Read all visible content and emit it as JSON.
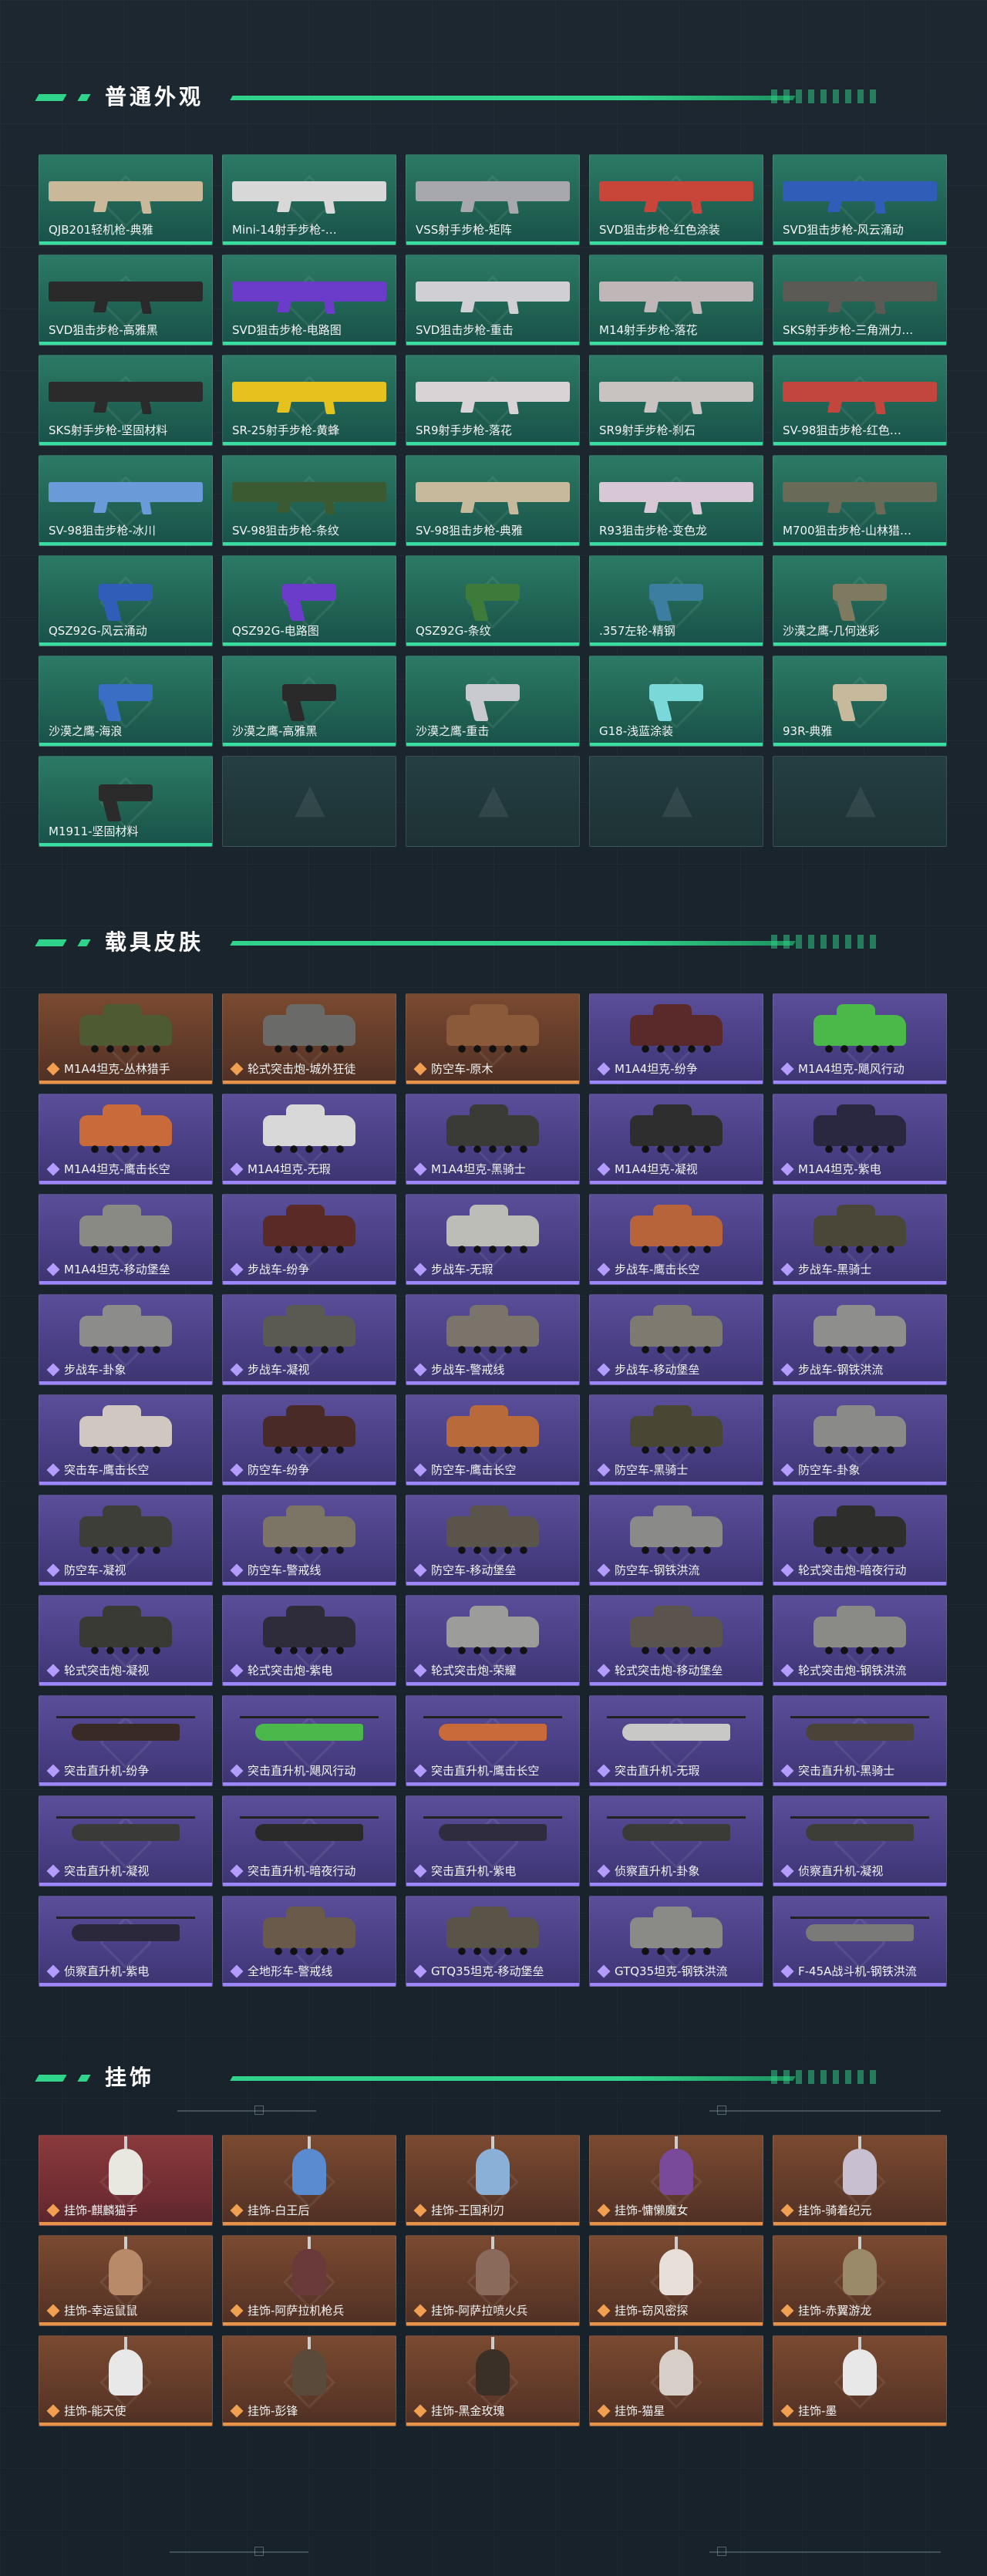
{
  "sections": {
    "weapons": {
      "title": "普通外观",
      "items": [
        {
          "label": "QJB201轻机枪-典雅",
          "color": "#c9b89a"
        },
        {
          "label": "Mini-14射手步枪-…",
          "color": "#d8d8d8"
        },
        {
          "label": "VSS射手步枪-矩阵",
          "color": "#a6a8ad"
        },
        {
          "label": "SVD狙击步枪-红色涂装",
          "color": "#c8453a"
        },
        {
          "label": "SVD狙击步枪-风云涌动",
          "color": "#2f5db8"
        },
        {
          "label": "SVD狙击步枪-高雅黑",
          "color": "#2a2a2a"
        },
        {
          "label": "SVD狙击步枪-电路图",
          "color": "#6a3cc9"
        },
        {
          "label": "SVD狙击步枪-重击",
          "color": "#cfcfd4"
        },
        {
          "label": "M14射手步枪-落花",
          "color": "#bfb7b7"
        },
        {
          "label": "SKS射手步枪-三角洲力…",
          "color": "#5c5a55"
        },
        {
          "label": "SKS射手步枪-坚固材料",
          "color": "#2b2b2b"
        },
        {
          "label": "SR-25射手步枪-黄蜂",
          "color": "#e6c21e"
        },
        {
          "label": "SR9射手步枪-落花",
          "color": "#dad3d6"
        },
        {
          "label": "SR9射手步枪-刹石",
          "color": "#c8c2c0"
        },
        {
          "label": "SV-98狙击步枪-红色…",
          "color": "#c2463e"
        },
        {
          "label": "SV-98狙击步枪-冰川",
          "color": "#6b9ad8"
        },
        {
          "label": "SV-98狙击步枪-条纹",
          "color": "#3c5a32"
        },
        {
          "label": "SV-98狙击步枪-典雅",
          "color": "#c7b99c"
        },
        {
          "label": "R93狙击步枪-变色龙",
          "color": "#d8c8d6"
        },
        {
          "label": "M700狙击步枪-山林猎…",
          "color": "#6a6a58"
        },
        {
          "label": "QSZ92G-风云涌动",
          "color": "#2f5db8"
        },
        {
          "label": "QSZ92G-电路图",
          "color": "#6a3cc9"
        },
        {
          "label": "QSZ92G-条纹",
          "color": "#3e7a3a"
        },
        {
          "label": ".357左轮-精钢",
          "color": "#3c7ea0"
        },
        {
          "label": "沙漠之鹰-几何迷彩",
          "color": "#7e7a60"
        },
        {
          "label": "沙漠之鹰-海浪",
          "color": "#3a6ec4"
        },
        {
          "label": "沙漠之鹰-高雅黑",
          "color": "#2a2a2a"
        },
        {
          "label": "沙漠之鹰-重击",
          "color": "#c8cad0"
        },
        {
          "label": "G18-浅蓝涂装",
          "color": "#7ad8d8"
        },
        {
          "label": "93R-典雅",
          "color": "#c7b99c"
        },
        {
          "label": "M1911-坚固材料",
          "color": "#2b2b2b"
        }
      ],
      "empty_count": 4
    },
    "vehicles": {
      "title": "载具皮肤",
      "items": [
        {
          "label": "M1A4坦克-丛林猎手",
          "tone": "orange",
          "color": "#4d5a32",
          "kind": "vehicle"
        },
        {
          "label": "轮式突击炮-城外狂徒",
          "tone": "orange",
          "color": "#6a6a68",
          "kind": "vehicle"
        },
        {
          "label": "防空车-原木",
          "tone": "orange",
          "color": "#8a5a3a",
          "kind": "vehicle"
        },
        {
          "label": "M1A4坦克-纷争",
          "tone": "purple",
          "color": "#5a2a2a",
          "kind": "vehicle"
        },
        {
          "label": "M1A4坦克-飓风行动",
          "tone": "purple",
          "color": "#4bb84a",
          "kind": "vehicle"
        },
        {
          "label": "M1A4坦克-鹰击长空",
          "tone": "purple",
          "color": "#c86a3a",
          "kind": "vehicle"
        },
        {
          "label": "M1A4坦克-无瑕",
          "tone": "purple",
          "color": "#d8d8d8",
          "kind": "vehicle"
        },
        {
          "label": "M1A4坦克-黑骑士",
          "tone": "purple",
          "color": "#3a3a36",
          "kind": "vehicle"
        },
        {
          "label": "M1A4坦克-凝视",
          "tone": "purple",
          "color": "#2e2e2e",
          "kind": "vehicle"
        },
        {
          "label": "M1A4坦克-紫电",
          "tone": "purple",
          "color": "#2a2840",
          "kind": "vehicle"
        },
        {
          "label": "M1A4坦克-移动堡垒",
          "tone": "purple",
          "color": "#8a8a84",
          "kind": "vehicle"
        },
        {
          "label": "步战车-纷争",
          "tone": "purple",
          "color": "#5a2a26",
          "kind": "vehicle"
        },
        {
          "label": "步战车-无瑕",
          "tone": "purple",
          "color": "#bdbdb8",
          "kind": "vehicle"
        },
        {
          "label": "步战车-鹰击长空",
          "tone": "purple",
          "color": "#b8643a",
          "kind": "vehicle"
        },
        {
          "label": "步战车-黑骑士",
          "tone": "purple",
          "color": "#4a4638",
          "kind": "vehicle"
        },
        {
          "label": "步战车-卦象",
          "tone": "purple",
          "color": "#8c8c8a",
          "kind": "vehicle"
        },
        {
          "label": "步战车-凝视",
          "tone": "purple",
          "color": "#5a5a52",
          "kind": "vehicle"
        },
        {
          "label": "步战车-警戒线",
          "tone": "purple",
          "color": "#7a746a",
          "kind": "vehicle"
        },
        {
          "label": "步战车-移动堡垒",
          "tone": "purple",
          "color": "#7e7a70",
          "kind": "vehicle"
        },
        {
          "label": "步战车-钢铁洪流",
          "tone": "purple",
          "color": "#8e8e8c",
          "kind": "vehicle"
        },
        {
          "label": "突击车-鹰击长空",
          "tone": "purple",
          "color": "#d0c8c0",
          "kind": "vehicle"
        },
        {
          "label": "防空车-纷争",
          "tone": "purple",
          "color": "#4a2a26",
          "kind": "vehicle"
        },
        {
          "label": "防空车-鹰击长空",
          "tone": "purple",
          "color": "#b86a3a",
          "kind": "vehicle"
        },
        {
          "label": "防空车-黑骑士",
          "tone": "purple",
          "color": "#4a4634",
          "kind": "vehicle"
        },
        {
          "label": "防空车-卦象",
          "tone": "purple",
          "color": "#8a8a88",
          "kind": "vehicle"
        },
        {
          "label": "防空车-凝视",
          "tone": "purple",
          "color": "#3e3e38",
          "kind": "vehicle"
        },
        {
          "label": "防空车-警戒线",
          "tone": "purple",
          "color": "#7c7464",
          "kind": "vehicle"
        },
        {
          "label": "防空车-移动堡垒",
          "tone": "purple",
          "color": "#5a544a",
          "kind": "vehicle"
        },
        {
          "label": "防空车-钢铁洪流",
          "tone": "purple",
          "color": "#8a8a88",
          "kind": "vehicle"
        },
        {
          "label": "轮式突击炮-暗夜行动",
          "tone": "purple",
          "color": "#2e2e2c",
          "kind": "vehicle"
        },
        {
          "label": "轮式突击炮-凝视",
          "tone": "purple",
          "color": "#3a3a34",
          "kind": "vehicle"
        },
        {
          "label": "轮式突击炮-紫电",
          "tone": "purple",
          "color": "#2e2c3a",
          "kind": "vehicle"
        },
        {
          "label": "轮式突击炮-荣耀",
          "tone": "purple",
          "color": "#9c9c9a",
          "kind": "vehicle"
        },
        {
          "label": "轮式突击炮-移动堡垒",
          "tone": "purple",
          "color": "#5a544c",
          "kind": "vehicle"
        },
        {
          "label": "轮式突击炮-钢铁洪流",
          "tone": "purple",
          "color": "#8a8a86",
          "kind": "vehicle"
        },
        {
          "label": "突击直升机-纷争",
          "tone": "purple",
          "color": "#3a2a26",
          "kind": "heli"
        },
        {
          "label": "突击直升机-飓风行动",
          "tone": "purple",
          "color": "#4ab84a",
          "kind": "heli"
        },
        {
          "label": "突击直升机-鹰击长空",
          "tone": "purple",
          "color": "#c86a3a",
          "kind": "heli"
        },
        {
          "label": "突击直升机-无瑕",
          "tone": "purple",
          "color": "#c8c8c6",
          "kind": "heli"
        },
        {
          "label": "突击直升机-黑骑士",
          "tone": "purple",
          "color": "#4a4438",
          "kind": "heli"
        },
        {
          "label": "突击直升机-凝视",
          "tone": "purple",
          "color": "#3a3a38",
          "kind": "heli"
        },
        {
          "label": "突击直升机-暗夜行动",
          "tone": "purple",
          "color": "#2a2a2a",
          "kind": "heli"
        },
        {
          "label": "突击直升机-紫电",
          "tone": "purple",
          "color": "#2e2c3e",
          "kind": "heli"
        },
        {
          "label": "侦察直升机-卦象",
          "tone": "purple",
          "color": "#3a3a36",
          "kind": "heli"
        },
        {
          "label": "侦察直升机-凝视",
          "tone": "purple",
          "color": "#3e3e38",
          "kind": "heli"
        },
        {
          "label": "侦察直升机-紫电",
          "tone": "purple",
          "color": "#2a283a",
          "kind": "heli"
        },
        {
          "label": "全地形车-警戒线",
          "tone": "purple",
          "color": "#6a5a4a",
          "kind": "vehicle"
        },
        {
          "label": "GTQ35坦克-移动堡垒",
          "tone": "purple",
          "color": "#5a5448",
          "kind": "vehicle"
        },
        {
          "label": "GTQ35坦克-钢铁洪流",
          "tone": "purple",
          "color": "#8a8a86",
          "kind": "vehicle"
        },
        {
          "label": "F-45A战斗机-钢铁洪流",
          "tone": "purple",
          "color": "#7a7a78",
          "kind": "heli"
        }
      ]
    },
    "charms": {
      "title": "挂饰",
      "items": [
        {
          "label": "挂饰-麒麟猫手",
          "tone": "red",
          "color": "#e8e8e0"
        },
        {
          "label": "挂饰-白王后",
          "tone": "orange",
          "color": "#5a8ad0"
        },
        {
          "label": "挂饰-王国利刃",
          "tone": "orange",
          "color": "#8ab0d8"
        },
        {
          "label": "挂饰-慵懒魔女",
          "tone": "orange",
          "color": "#7a4a9a"
        },
        {
          "label": "挂饰-骑着纪元",
          "tone": "orange",
          "color": "#c8c0d0"
        },
        {
          "label": "挂饰-幸运鼠鼠",
          "tone": "orange",
          "color": "#b88a6a"
        },
        {
          "label": "挂饰-阿萨拉机枪兵",
          "tone": "orange",
          "color": "#6a3a3a"
        },
        {
          "label": "挂饰-阿萨拉喷火兵",
          "tone": "orange",
          "color": "#8a6a5a"
        },
        {
          "label": "挂饰-窃风密探",
          "tone": "orange",
          "color": "#e8e0d8"
        },
        {
          "label": "挂饰-赤翼游龙",
          "tone": "orange",
          "color": "#9a8a6a"
        },
        {
          "label": "挂饰-能天使",
          "tone": "orange",
          "color": "#e8e8e8"
        },
        {
          "label": "挂饰-彭锋",
          "tone": "orange",
          "color": "#5a4a3a"
        },
        {
          "label": "挂饰-黑金玫瑰",
          "tone": "orange",
          "color": "#3a3028"
        },
        {
          "label": "挂饰-猫星",
          "tone": "orange",
          "color": "#d8d0c8"
        },
        {
          "label": "挂饰-墨",
          "tone": "orange",
          "color": "#e8e8e8"
        }
      ]
    }
  }
}
